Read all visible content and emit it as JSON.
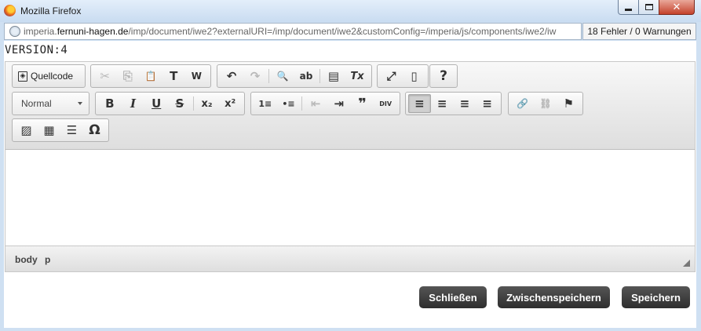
{
  "window": {
    "title": "Mozilla Firefox",
    "close_glyph": "✕"
  },
  "address_bar": {
    "url_prefix": "imperia.",
    "url_host": "fernuni-hagen.de",
    "url_rest": "/imp/document/iwe2?externalURI=/imp/document/iwe2&customConfig=/imperia/js/components/iwe2/iw",
    "errors": "18 Fehler / 0 Warnungen"
  },
  "header": {
    "version_label": "VERSION:4"
  },
  "toolbar": {
    "source_label": "Quellcode",
    "format_value": "Normal",
    "glyphs": {
      "source": "◈",
      "cut": "✂",
      "copy": "⎘",
      "paste": "📋",
      "paste_text": "T",
      "paste_word": "W",
      "undo": "↶",
      "redo": "↷",
      "find": "🔍",
      "replace": "ab",
      "select_all": "▤",
      "remove_format": "Tx",
      "maximize": "⤢",
      "show_blocks": "▯",
      "help": "?",
      "bold": "B",
      "italic": "I",
      "underline": "U",
      "strike": "S",
      "subscript": "x₂",
      "superscript": "x²",
      "numbered_list": "1≡",
      "bulleted_list": "•≡",
      "outdent": "⇤",
      "indent": "⇥",
      "blockquote": "❞",
      "div": "DIV",
      "align_left": "≡",
      "align_center": "≡",
      "align_right": "≡",
      "justify": "≡",
      "link": "🔗",
      "unlink": "⛓",
      "anchor": "⚑",
      "image": "▨",
      "table": "▦",
      "horizontal_rule": "☰",
      "special_char": "Ω"
    }
  },
  "pathbar": {
    "items": [
      "body",
      "p"
    ]
  },
  "actions": {
    "close": "Schließen",
    "save_draft": "Zwischenspeichern",
    "save": "Speichern"
  }
}
